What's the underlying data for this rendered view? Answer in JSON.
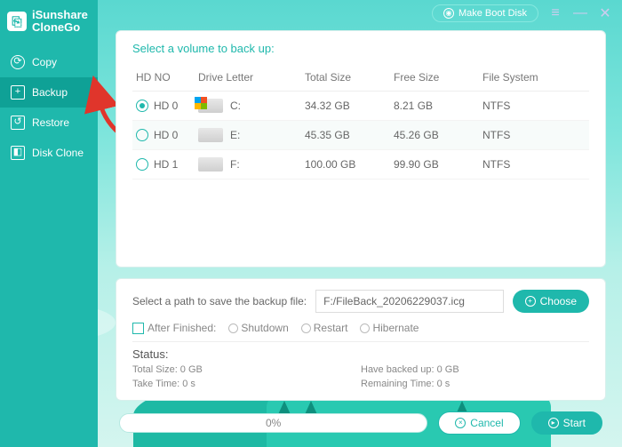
{
  "app": {
    "brand1": "iSunshare",
    "brand2": "CloneGo"
  },
  "topbar": {
    "make_boot": "Make Boot Disk"
  },
  "sidebar": {
    "items": [
      {
        "label": "Copy"
      },
      {
        "label": "Backup"
      },
      {
        "label": "Restore"
      },
      {
        "label": "Disk Clone"
      }
    ]
  },
  "volumes": {
    "title": "Select a volume to back up:",
    "headers": {
      "hd": "HD NO",
      "drive": "Drive Letter",
      "total": "Total Size",
      "free": "Free Size",
      "fs": "File System"
    },
    "rows": [
      {
        "selected": true,
        "hd": "HD 0",
        "letter": "C:",
        "total": "34.32 GB",
        "free": "8.21 GB",
        "fs": "NTFS"
      },
      {
        "selected": false,
        "hd": "HD 0",
        "letter": "E:",
        "total": "45.35 GB",
        "free": "45.26 GB",
        "fs": "NTFS"
      },
      {
        "selected": false,
        "hd": "HD 1",
        "letter": "F:",
        "total": "100.00 GB",
        "free": "99.90 GB",
        "fs": "NTFS"
      }
    ]
  },
  "options": {
    "path_label": "Select a path to save the backup file:",
    "path_value": "F:/FileBack_20206229037.icg",
    "choose": "Choose",
    "after_label": "After Finished:",
    "after_opts": {
      "shutdown": "Shutdown",
      "restart": "Restart",
      "hibernate": "Hibernate"
    },
    "status_title": "Status:",
    "status": {
      "total": "Total Size: 0 GB",
      "backed": "Have backed up: 0 GB",
      "take": "Take Time: 0 s",
      "remain": "Remaining Time: 0 s"
    }
  },
  "actions": {
    "progress": "0%",
    "cancel": "Cancel",
    "start": "Start"
  }
}
